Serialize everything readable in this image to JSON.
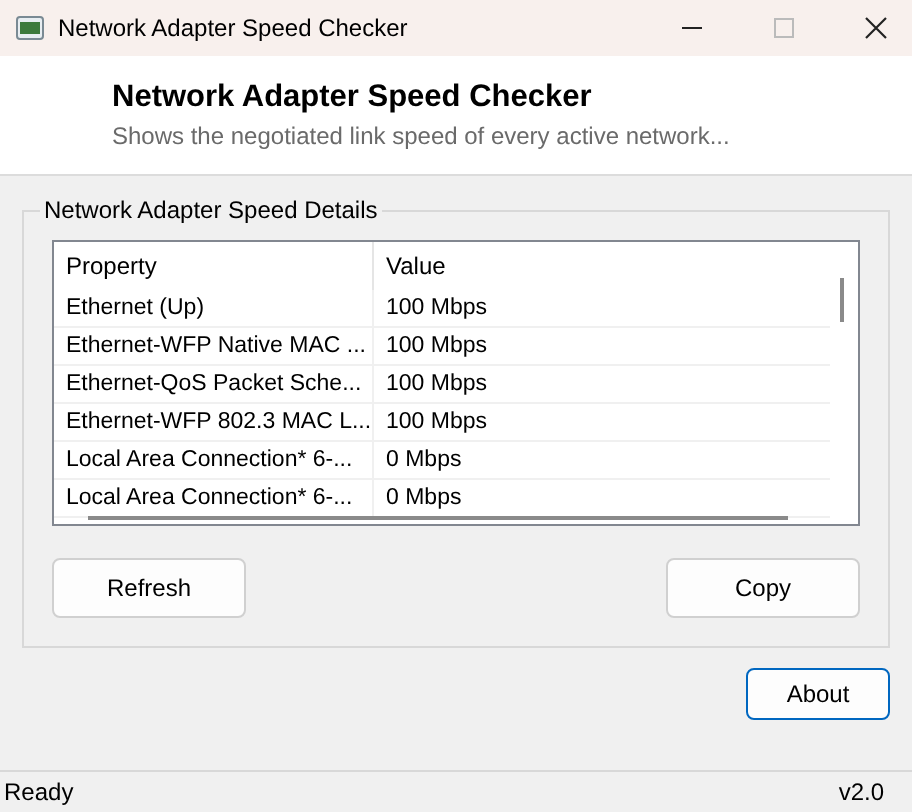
{
  "window": {
    "title": "Network Adapter Speed Checker"
  },
  "header": {
    "title": "Network Adapter Speed Checker",
    "subtitle": "Shows the negotiated link speed of every active network..."
  },
  "group": {
    "title": "Network Adapter Speed Details"
  },
  "table": {
    "columns": [
      "Property",
      "Value"
    ],
    "rows": [
      {
        "property": "Ethernet (Up)",
        "value": "100 Mbps"
      },
      {
        "property": "Ethernet-WFP Native MAC ...",
        "value": "100 Mbps"
      },
      {
        "property": "Ethernet-QoS Packet Sche...",
        "value": "100 Mbps"
      },
      {
        "property": "Ethernet-WFP 802.3 MAC L...",
        "value": "100 Mbps"
      },
      {
        "property": "Local Area Connection* 6-...",
        "value": "0 Mbps"
      },
      {
        "property": "Local Area Connection* 6-...",
        "value": "0 Mbps"
      }
    ]
  },
  "buttons": {
    "left": "Refresh",
    "right": "Copy",
    "about": "About"
  },
  "status_bar": {
    "status": "Ready",
    "version": "v2.0"
  }
}
